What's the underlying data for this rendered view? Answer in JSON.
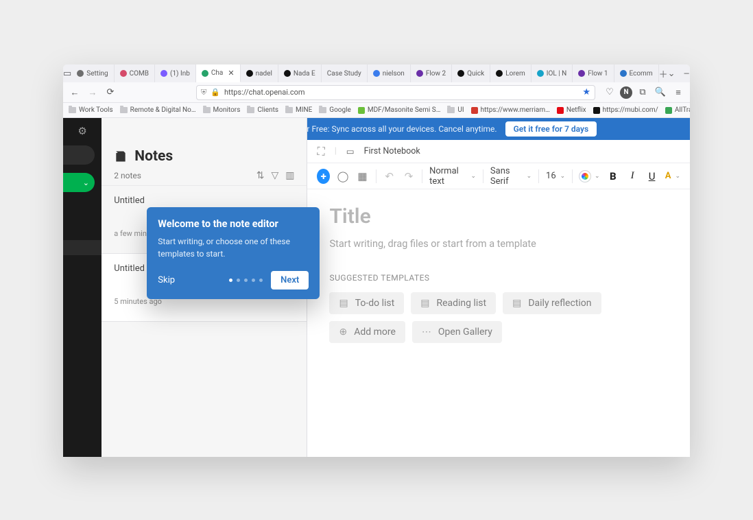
{
  "browser": {
    "tabs": [
      {
        "label": "Setting",
        "favicon": "#6e6e6e"
      },
      {
        "label": "COMB",
        "favicon": "#d54b6a"
      },
      {
        "label": "(1) Inb",
        "favicon": "#7b5cff"
      },
      {
        "label": "Cha",
        "favicon": "#27a36a",
        "active": true,
        "closeable": true
      },
      {
        "label": "nadel",
        "favicon": "#111"
      },
      {
        "label": "Nada E",
        "favicon": "#111"
      },
      {
        "label": "Case Study",
        "favicon": ""
      },
      {
        "label": "nielson",
        "favicon": "#3b7ded"
      },
      {
        "label": "Flow 2",
        "favicon": "#6a2fa8"
      },
      {
        "label": "Quick",
        "favicon": "#111"
      },
      {
        "label": "Lorem",
        "favicon": "#111"
      },
      {
        "label": "IOL | N",
        "favicon": "#17a3c9"
      },
      {
        "label": "Flow 1",
        "favicon": "#6a2fa8"
      },
      {
        "label": "Ecomm",
        "favicon": "#2a74c9"
      }
    ],
    "url": "https://chat.openai.com",
    "bookmarks": [
      {
        "label": "Work Tools",
        "type": "folder"
      },
      {
        "label": "Remote & Digital No…",
        "type": "folder"
      },
      {
        "label": "Monitors",
        "type": "folder"
      },
      {
        "label": "Clients",
        "type": "folder"
      },
      {
        "label": "MINE",
        "type": "folder"
      },
      {
        "label": "Google",
        "type": "folder"
      },
      {
        "label": "MDF/Masonite Semi S…",
        "type": "link",
        "favicon": "#6bbf3b"
      },
      {
        "label": "UI",
        "type": "folder"
      },
      {
        "label": "https://www.merriam…",
        "type": "link",
        "favicon": "#d33a2e"
      },
      {
        "label": "Netflix",
        "type": "link",
        "favicon": "#e50914"
      },
      {
        "label": "https://mubi.com/",
        "type": "link",
        "favicon": "#111"
      },
      {
        "label": "AllTrails map legend – …",
        "type": "link",
        "favicon": "#3aa655"
      }
    ]
  },
  "promo": {
    "text": "Try Evernote Personal for Free:  Sync across all your devices. Cancel anytime.",
    "cta": "Get it free for 7 days"
  },
  "notes_panel": {
    "title": "Notes",
    "count": "2 notes",
    "items": [
      {
        "name": "Untitled",
        "time": "a few minutes"
      },
      {
        "name": "Untitled",
        "time": "5 minutes ago"
      }
    ]
  },
  "onboarding": {
    "title": "Welcome to the note editor",
    "body": "Start writing, or choose one of these templates to start.",
    "skip": "Skip",
    "next": "Next"
  },
  "editor": {
    "notebook": "First Notebook",
    "text_style": "Normal text",
    "font": "Sans Serif",
    "size": "16",
    "title_placeholder": "Title",
    "hint": "Start writing, drag files or start from a template",
    "templates_header": "SUGGESTED TEMPLATES",
    "templates": [
      {
        "icon": "list",
        "label": "To-do list"
      },
      {
        "icon": "list",
        "label": "Reading list"
      },
      {
        "icon": "list",
        "label": "Daily reflection"
      },
      {
        "icon": "plus",
        "label": "Add more"
      },
      {
        "icon": "dots",
        "label": "Open Gallery"
      }
    ]
  }
}
